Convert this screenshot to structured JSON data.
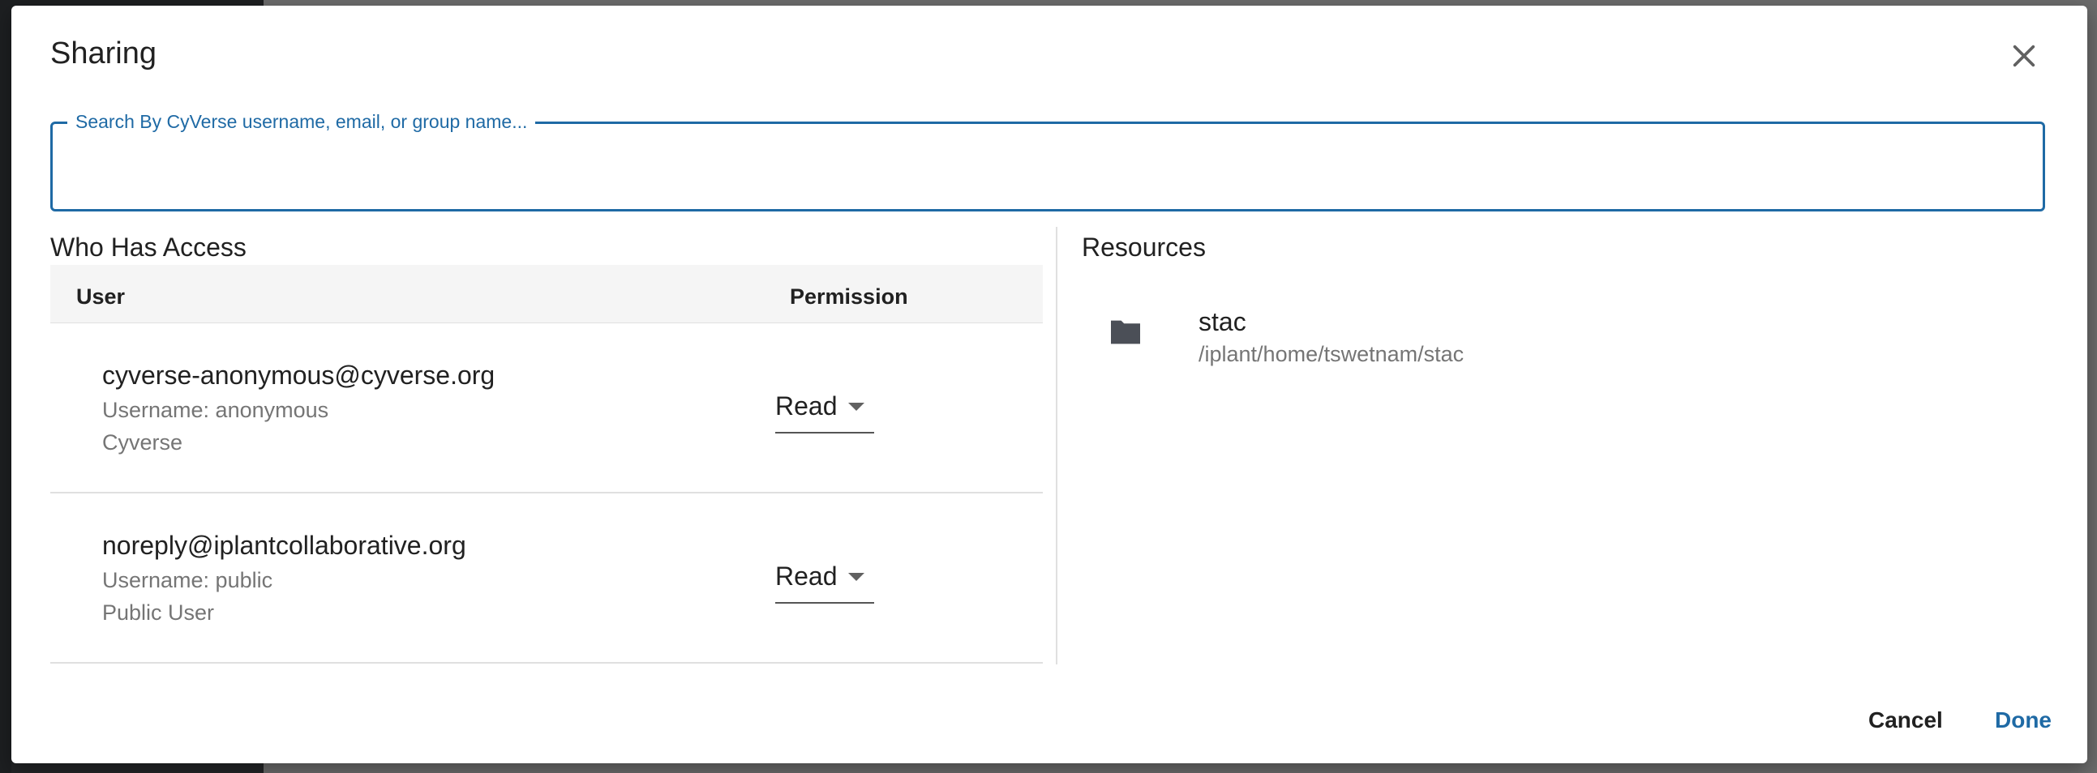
{
  "dialog": {
    "title": "Sharing",
    "search": {
      "label": "Search By CyVerse username, email, or group name...",
      "value": ""
    },
    "who_has_access": {
      "title": "Who Has Access",
      "columns": [
        "User",
        "Permission"
      ],
      "rows": [
        {
          "email": "cyverse-anonymous@cyverse.org",
          "username": "Username: anonymous",
          "org": "Cyverse",
          "permission": "Read"
        },
        {
          "email": "noreply@iplantcollaborative.org",
          "username": "Username: public",
          "org": "Public User",
          "permission": "Read"
        }
      ]
    },
    "resources": {
      "title": "Resources",
      "items": [
        {
          "name": "stac",
          "path": "/iplant/home/tswetnam/stac",
          "icon": "folder-icon"
        }
      ]
    },
    "actions": {
      "cancel": "Cancel",
      "done": "Done"
    }
  },
  "colors": {
    "accent": "#1f6aa5",
    "text_primary": "#212121",
    "text_secondary": "#757575"
  }
}
